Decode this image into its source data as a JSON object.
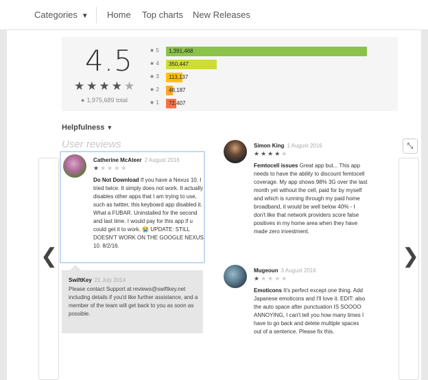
{
  "nav": {
    "categories": "Categories",
    "home": "Home",
    "top_charts": "Top charts",
    "new_releases": "New Releases"
  },
  "rating": {
    "score": "4.5",
    "stars_display": "★★★★★",
    "total": "1,975,689 total",
    "histogram": [
      {
        "label": "5",
        "count_text": "1,391,468",
        "fraction": 0.7043,
        "color": "#8bc34a"
      },
      {
        "label": "4",
        "count_text": "350,447",
        "fraction": 0.1774,
        "color": "#cddc39"
      },
      {
        "label": "3",
        "count_text": "113,137",
        "fraction": 0.0573,
        "color": "#ffc107"
      },
      {
        "label": "2",
        "count_text": "48,187",
        "fraction": 0.0244,
        "color": "#ffa726"
      },
      {
        "label": "1",
        "count_text": "72,407",
        "fraction": 0.0366,
        "color": "#ff7043"
      }
    ]
  },
  "helpfulness": "Helpfulness",
  "user_reviews_title": "User reviews",
  "reviews": [
    {
      "author": "Catherine McAteer",
      "date": "2 August 2016",
      "stars": 1,
      "title": "Do Not Download",
      "text": "If you have a Nexus 10. I tried twice. It simply does not work. It actually disables other apps that I am trying to use, such as twitter, this keyboard app disabled it. What a FUBAR. Uninstalled for the second and last time. I would pay for this app if u could get it to work. 😭 UPDATE: STILL DOESN'T WORK ON THE GOOGLE NEXUS 10. 8/2/16."
    },
    {
      "author": "Simon King",
      "date": "1 August 2016",
      "stars": 4,
      "title": "Femtocell issues",
      "text": "Great app but... This app needs to have the ability to discount femtocell coverage. My app shows 98% 3G over the last month yet without the cell, paid for by myself and which is running through my paid home broadband, it would be well below 40% - I don't like that network providers score false positives in my home area when they have made zero investment."
    },
    {
      "author": "Mugeoun",
      "date": "3 August 2016",
      "stars": 1,
      "title": "Emoticons",
      "text": "It's perfect except one thing. Add Japanese emoticons and I'll love it. EDIT: also the auto space after punctuation IS SOOOO ANNOYING, I can't tell you how many times I have to go back and delete multiple spaces out of a sentence. Please fix this."
    }
  ],
  "developer_reply": {
    "author": "SwiftKey",
    "date": "21 July 2014",
    "text": "Please contact Support at reviews@swiftkey.net including details if you'd like further assistance, and a member of the team will get back to you as soon as possible."
  },
  "icons": {
    "prev": "chevron-left-icon",
    "next": "chevron-right-icon",
    "collapse": "collapse-icon"
  }
}
